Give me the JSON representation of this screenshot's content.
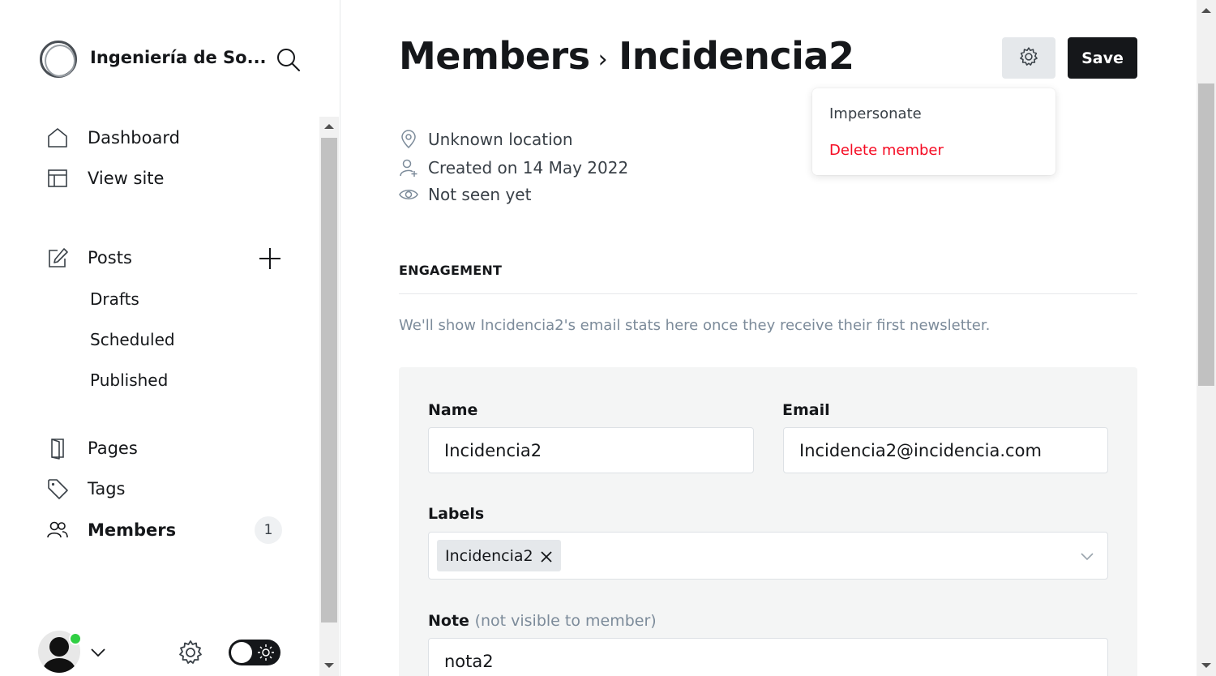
{
  "sidebar": {
    "site_title": "Ingeniería de So...",
    "nav": {
      "dashboard": "Dashboard",
      "view_site": "View site",
      "posts": "Posts",
      "drafts": "Drafts",
      "scheduled": "Scheduled",
      "published": "Published",
      "pages": "Pages",
      "tags": "Tags",
      "members": "Members",
      "members_count": "1"
    },
    "icons": [
      "search-icon",
      "home-icon",
      "layout-icon",
      "edit-icon",
      "plus-icon",
      "page-icon",
      "tag-icon",
      "members-icon",
      "settings-icon",
      "sun-icon",
      "chevron-down-icon"
    ],
    "user_status": "online",
    "theme": "dark-toggle"
  },
  "header": {
    "parent": "Members",
    "current": "Incidencia2",
    "save_label": "Save"
  },
  "dropdown": {
    "impersonate": "Impersonate",
    "delete": "Delete member"
  },
  "meta": {
    "location": "Unknown location",
    "created": "Created on 14 May 2022",
    "seen": "Not seen yet"
  },
  "engagement": {
    "title": "ENGAGEMENT",
    "message": "We'll show Incidencia2's email stats here once they receive their first newsletter."
  },
  "form": {
    "name_label": "Name",
    "name_value": "Incidencia2",
    "email_label": "Email",
    "email_value": "Incidencia2@incidencia.com",
    "labels_label": "Labels",
    "label_token": "Incidencia2",
    "note_label": "Note",
    "note_hint": "(not visible to member)",
    "note_value": "nota2"
  },
  "colors": {
    "accent_dark": "#15171a",
    "danger": "#f50b23",
    "muted": "#7c8b9a",
    "online": "#30cf43"
  }
}
